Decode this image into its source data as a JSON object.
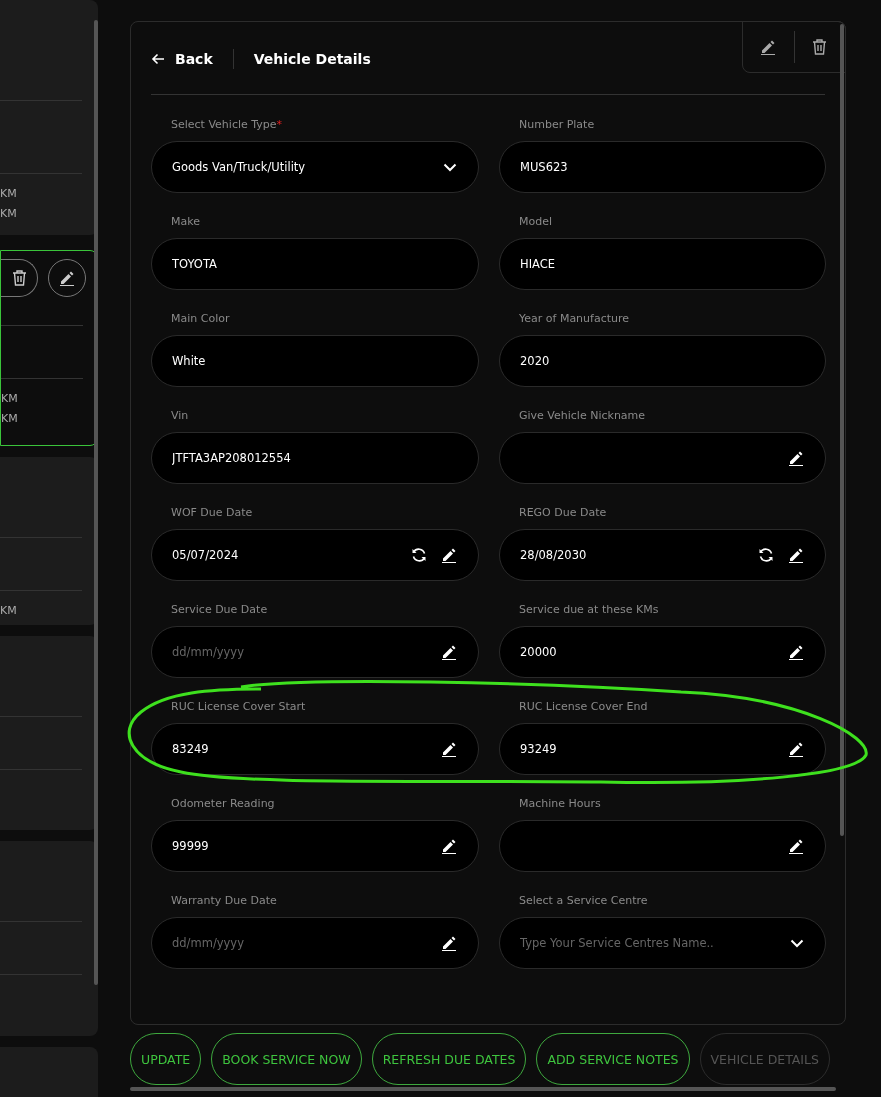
{
  "vehicle_cards": [
    {
      "selected": false,
      "readings": [
        "KM",
        "KM"
      ],
      "actions": false
    },
    {
      "selected": true,
      "readings": [
        "KM",
        "KM"
      ],
      "actions": true
    },
    {
      "selected": false,
      "readings": [
        "KM"
      ],
      "actions": false
    },
    {
      "selected": false,
      "actions": false
    },
    {
      "selected": false,
      "actions": false
    },
    {
      "selected": false
    }
  ],
  "header": {
    "back": "Back",
    "title": "Vehicle Details"
  },
  "fields": [
    {
      "kind": "select",
      "label": "Select Vehicle Type",
      "required_mark": "*",
      "value": "Goods Van/Truck/Utility"
    },
    {
      "kind": "text",
      "label": "Number Plate",
      "value": "MUS623"
    },
    {
      "kind": "text",
      "label": "Make",
      "value": "TOYOTA"
    },
    {
      "kind": "text",
      "label": "Model",
      "value": "HIACE"
    },
    {
      "kind": "text",
      "label": "Main Color",
      "value": "White"
    },
    {
      "kind": "text",
      "label": "Year of Manufacture",
      "value": "2020"
    },
    {
      "kind": "text",
      "label": "Vin",
      "value": "JTFTA3AP208012554"
    },
    {
      "kind": "edit",
      "label": "Give Vehicle Nickname"
    },
    {
      "kind": "due",
      "label": "WOF Due Date",
      "value": "05/07/2024"
    },
    {
      "kind": "due",
      "label": "REGO Due Date",
      "value": "28/08/2030"
    },
    {
      "kind": "edit",
      "label": "Service Due Date",
      "placeholder": "dd/mm/yyyy"
    },
    {
      "kind": "edit",
      "label": "Service due at these KMs",
      "value": "20000"
    },
    {
      "kind": "edit",
      "label": "RUC License Cover Start",
      "value": "83249"
    },
    {
      "kind": "edit",
      "label": "RUC License Cover End",
      "value": "93249"
    },
    {
      "kind": "edit",
      "label": "Odometer Reading",
      "value": "99999"
    },
    {
      "kind": "edit",
      "label": "Machine Hours"
    },
    {
      "kind": "edit",
      "label": "Warranty Due Date",
      "placeholder": "dd/mm/yyyy"
    },
    {
      "kind": "select",
      "label": "Select a Service Centre",
      "placeholder": "Type Your Service Centres Name.."
    }
  ],
  "buttons": [
    {
      "label": "UPDATE",
      "disabled": false
    },
    {
      "label": "BOOK SERVICE NOW",
      "disabled": false
    },
    {
      "label": "REFRESH DUE DATES",
      "disabled": false
    },
    {
      "label": "ADD SERVICE NOTES",
      "disabled": false
    },
    {
      "label": "VEHICLE DETAILS",
      "disabled": true
    }
  ]
}
